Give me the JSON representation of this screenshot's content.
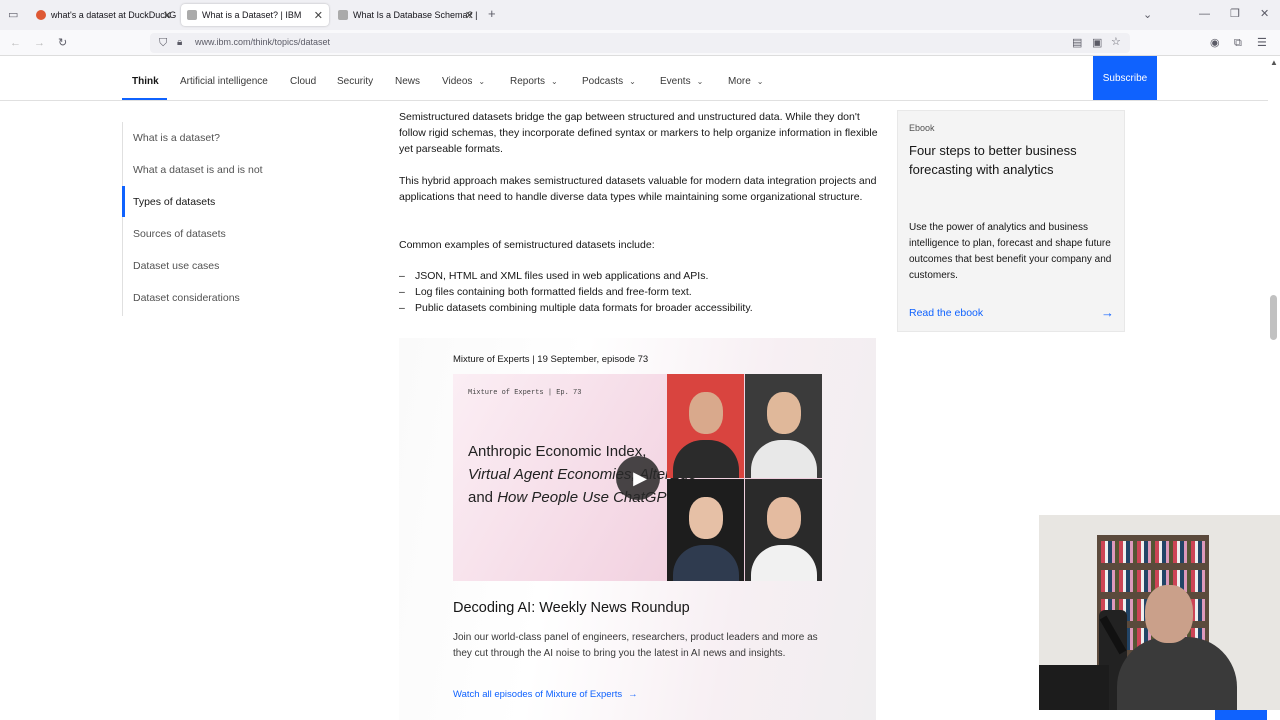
{
  "browser": {
    "tabs": [
      {
        "title": "what's a dataset at DuckDuckG",
        "active": false,
        "favicon_color": "#de5833"
      },
      {
        "title": "What is a Dataset? | IBM",
        "active": true,
        "favicon_color": "#888888"
      },
      {
        "title": "What Is a Database Schema? | I",
        "active": false,
        "favicon_color": "#888888"
      }
    ],
    "new_tab": "+",
    "url": "www.ibm.com/think/topics/dataset"
  },
  "nav": {
    "items": [
      {
        "label": "Think",
        "dropdown": false
      },
      {
        "label": "Artificial intelligence",
        "dropdown": false
      },
      {
        "label": "Cloud",
        "dropdown": false
      },
      {
        "label": "Security",
        "dropdown": false
      },
      {
        "label": "News",
        "dropdown": false
      },
      {
        "label": "Videos",
        "dropdown": true
      },
      {
        "label": "Reports",
        "dropdown": true
      },
      {
        "label": "Podcasts",
        "dropdown": true
      },
      {
        "label": "Events",
        "dropdown": true
      },
      {
        "label": "More",
        "dropdown": true
      }
    ],
    "subscribe": "Subscribe"
  },
  "toc": {
    "items": [
      "What is a dataset?",
      "What a dataset is and is not",
      "Types of datasets",
      "Sources of datasets",
      "Dataset use cases",
      "Dataset considerations"
    ],
    "active_index": 2
  },
  "article": {
    "para1": "Semistructured datasets bridge the gap between structured and unstructured data. While they don't follow rigid schemas, they incorporate defined syntax or markers to help organize information in flexible yet parseable formats.",
    "para2": "This hybrid approach makes semistructured datasets valuable for modern data integration projects and applications that need to handle diverse data types while maintaining some organizational structure.",
    "para3": "Common examples of semistructured datasets include:",
    "list": [
      "JSON, HTML and XML files used in web applications and APIs.",
      "Log files containing both formatted fields and free-form text.",
      "Public datasets combining multiple data formats for broader accessibility."
    ]
  },
  "ebook": {
    "label": "Ebook",
    "title": "Four steps to better business forecasting with analytics",
    "description": "Use the power of analytics and business intelligence to plan, forecast and shape future outcomes that best benefit your company and customers.",
    "link": "Read the ebook"
  },
  "video": {
    "meta": "Mixture of Experts | 19 September, episode 73",
    "thumb_small": "Mixture of Experts | Ep. 73",
    "thumb_line1": "Anthropic Economic Index,",
    "thumb_line2": "Virtual Agent Economies, AlterEgo",
    "thumb_line3a": "and ",
    "thumb_line3b": "How People Use ChatGPT",
    "title": "Decoding AI: Weekly News Roundup",
    "description": "Join our world-class panel of engineers, researchers, product leaders and more as they cut through the AI noise to bring you the latest in AI news and insights.",
    "link": "Watch all episodes of Mixture of Experts"
  },
  "colors": {
    "accent": "#0f62fe",
    "text": "#161616"
  }
}
